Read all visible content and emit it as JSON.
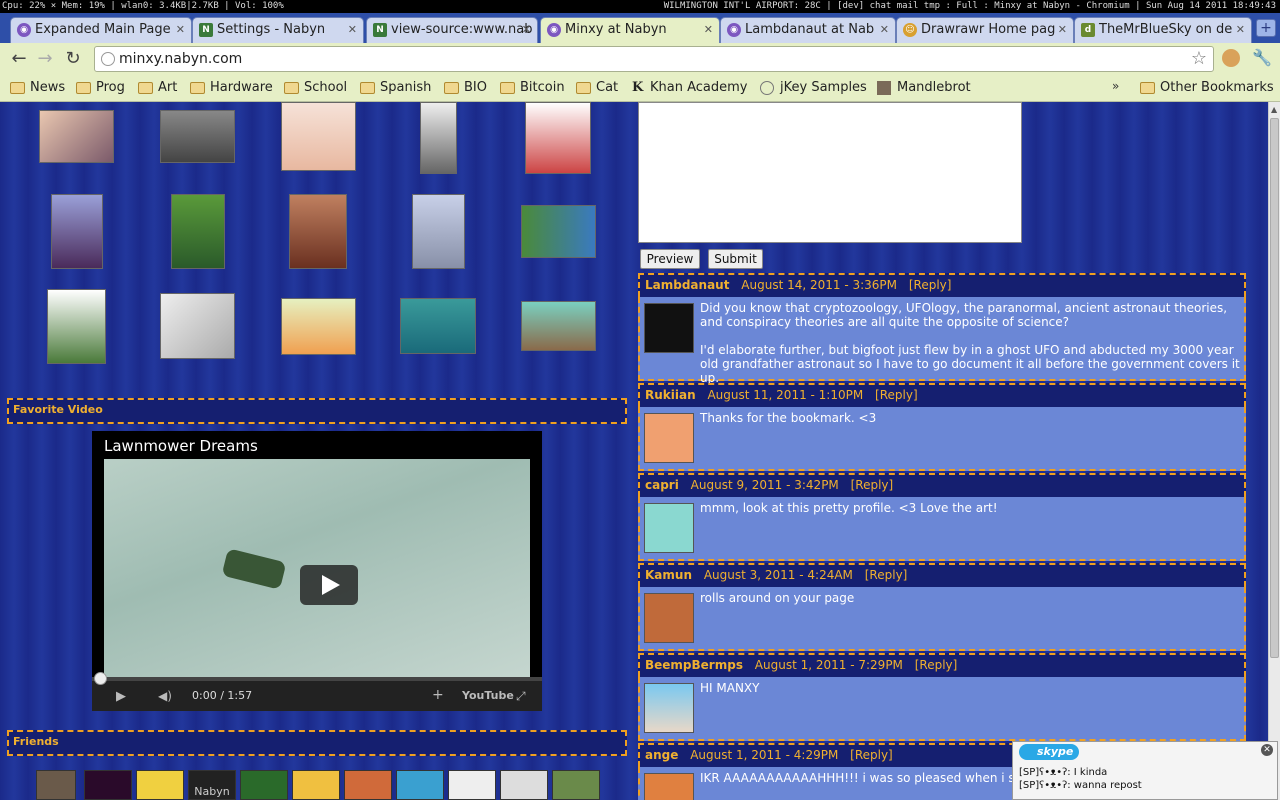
{
  "statusbar": {
    "left": "Cpu: 22% × Mem: 19% | wlan0: 3.4KB|2.7KB | Vol: 100%",
    "right": "WILMINGTON INT'L AIRPORT: 28C | [dev] chat mail tmp : Full : Minxy at Nabyn - Chromium | Sun Aug 14 2011 18:49:43"
  },
  "tabs": [
    {
      "label": "Expanded Main Page",
      "icon": "globe-icon"
    },
    {
      "label": "Settings - Nabyn",
      "icon": "nabyn-icon"
    },
    {
      "label": "view-source:www.nab",
      "icon": "nabyn-icon"
    },
    {
      "label": "Minxy at Nabyn",
      "icon": "globe-icon"
    },
    {
      "label": "Lambdanaut at Nab",
      "icon": "globe-icon"
    },
    {
      "label": "Drawrawr Home pag",
      "icon": "drawrawr-icon"
    },
    {
      "label": "TheMrBlueSky on de",
      "icon": "deviantart-icon"
    }
  ],
  "address": {
    "url": "minxy.nabyn.com"
  },
  "bookmarks": [
    {
      "label": "News",
      "icon": "folder"
    },
    {
      "label": "Prog",
      "icon": "folder"
    },
    {
      "label": "Art",
      "icon": "folder"
    },
    {
      "label": "Hardware",
      "icon": "folder"
    },
    {
      "label": "School",
      "icon": "folder"
    },
    {
      "label": "Spanish",
      "icon": "folder"
    },
    {
      "label": "BIO",
      "icon": "folder"
    },
    {
      "label": "Bitcoin",
      "icon": "folder"
    },
    {
      "label": "Cat",
      "icon": "folder"
    },
    {
      "label": "Khan Academy",
      "icon": "khan"
    },
    {
      "label": "jKey Samples",
      "icon": "globe"
    },
    {
      "label": "Mandlebrot",
      "icon": "image"
    }
  ],
  "other_bookmarks": "Other Bookmarks",
  "bookmarks_overflow": "»",
  "favorite_video": {
    "heading": "Favorite Video",
    "title": "Lawnmower Dreams",
    "time": "0:00 / 1:57"
  },
  "friends": {
    "heading": "Friends",
    "nabyn_label": "Nabyn"
  },
  "form": {
    "preview": "Preview",
    "submit": "Submit"
  },
  "comments": [
    {
      "name": "Lambdanaut",
      "date": "August 14, 2011 - 3:36PM",
      "reply": "[Reply]",
      "text1": "Did you know that cryptozoology, UFOlogy, the paranormal, ancient astronaut theories, and conspiracy theories are all quite the opposite of science?",
      "text2": "I'd elaborate further, but bigfoot just flew by in a ghost UFO and abducted my 3000 year old grandfather astronaut so I have to go document it all before the government covers it up."
    },
    {
      "name": "Rukiian",
      "date": "August 11, 2011 - 1:10PM",
      "reply": "[Reply]",
      "text1": "Thanks for the bookmark. <3"
    },
    {
      "name": "capri",
      "date": "August 9, 2011 - 3:42PM",
      "reply": "[Reply]",
      "text1": "mmm, look at this pretty profile. <3 Love the art!"
    },
    {
      "name": "Kamun",
      "date": "August 3, 2011 - 4:24AM",
      "reply": "[Reply]",
      "text1": "rolls around on your page"
    },
    {
      "name": "BeempBermps",
      "date": "August 1, 2011 - 7:29PM",
      "reply": "[Reply]",
      "text1": "HI MANXY"
    },
    {
      "name": "ange",
      "date": "August 1, 2011 - 4:29PM",
      "reply": "[Reply]",
      "text1": "IKR AAAAAAAAAAAHHH!!! i was so pleased when i saw yo"
    }
  ],
  "skype": {
    "brand": "skype",
    "line1": "[SP]ʕ•ᴥ•ʔ: I kinda",
    "line2": "[SP]ʕ•ᴥ•ʔ: wanna repost"
  }
}
